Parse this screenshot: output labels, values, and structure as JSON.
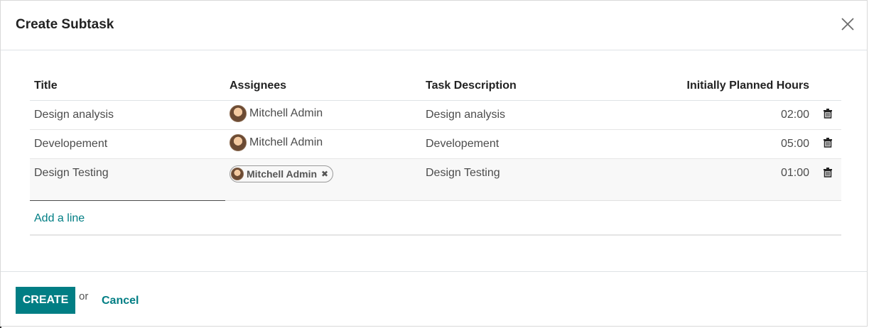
{
  "dialog": {
    "title": "Create Subtask"
  },
  "table": {
    "columns": [
      "Title",
      "Assignees",
      "Task Description",
      "Initially Planned Hours"
    ],
    "rows": [
      {
        "title": "Design analysis",
        "assignee": "Mitchell Admin",
        "description": "Design analysis",
        "hours": "02:00"
      },
      {
        "title": "Developement",
        "assignee": "Mitchell Admin",
        "description": "Developement",
        "hours": "05:00"
      },
      {
        "title": "Design Testing",
        "assignee": "Mitchell Admin",
        "description": "Design Testing",
        "hours": "01:00"
      }
    ],
    "add_line_label": "Add a line"
  },
  "footer": {
    "create_label": "CREATE",
    "or_label": "or",
    "cancel_label": "Cancel"
  },
  "icons": {
    "close": "close-icon",
    "delete": "trash-icon",
    "remove_tag": "remove-tag-icon",
    "avatar": "avatar"
  },
  "colors": {
    "primary": "#017e84"
  }
}
